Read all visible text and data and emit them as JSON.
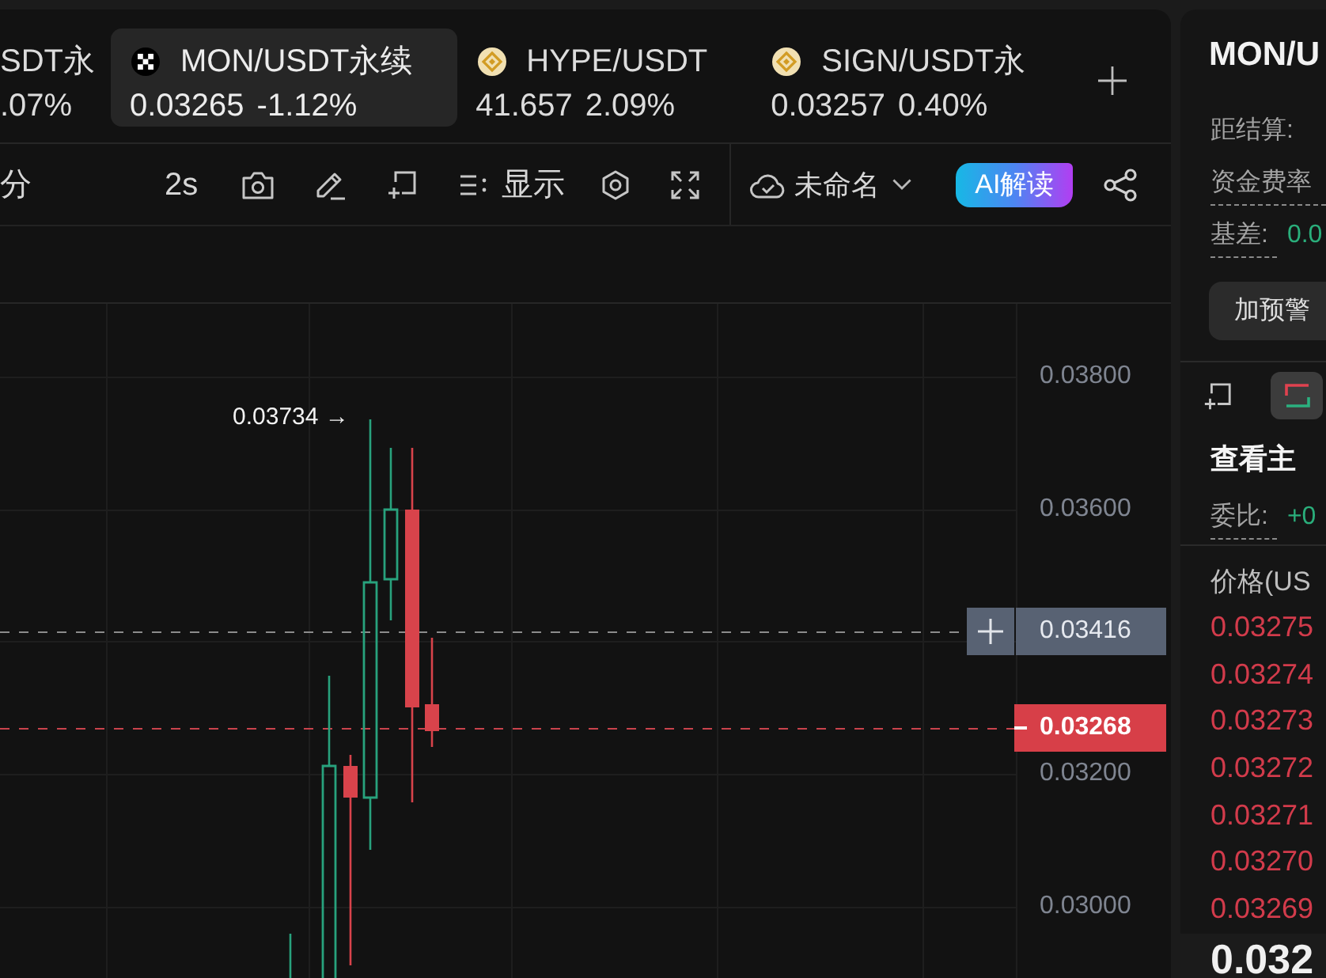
{
  "tabs": [
    {
      "kind": "plain",
      "symbol": "SDT永",
      "change": ".07%",
      "selected": false
    },
    {
      "kind": "checker",
      "symbol": "MON/USDT永续",
      "price": "0.03265",
      "change": "-1.12%",
      "selected": true
    },
    {
      "kind": "coin",
      "symbol": "HYPE/USDT",
      "price": "41.657",
      "change": "2.09%",
      "selected": false
    },
    {
      "kind": "coin",
      "symbol": "SIGN/USDT永",
      "price": "0.03257",
      "change": "0.40%",
      "selected": false
    }
  ],
  "toolbar": {
    "interval": "分",
    "refresh": "2s",
    "display": "显示",
    "template": "未命名",
    "ai_button": "AI解读"
  },
  "chart": {
    "high_label": "0.03734 →",
    "price_axis": [
      "0.03800",
      "0.03600",
      "0.03200",
      "0.03000"
    ],
    "crosshair_price": "0.03416",
    "last_price": "0.03268"
  },
  "info_panel": {
    "title": "MON/U",
    "settlement_label": "距结算:",
    "funding_label": "资金费率",
    "basis_label": "基差:",
    "basis_value": "0.0",
    "alert_button": "加预警"
  },
  "order_book": {
    "title": "查看主",
    "ratio_label": "委比:",
    "ratio_value": "+0",
    "price_header": "价格(US",
    "asks": [
      "0.03275",
      "0.03274",
      "0.03273",
      "0.03272",
      "0.03271",
      "0.03270",
      "0.03269"
    ],
    "last_price": "0.032"
  }
}
